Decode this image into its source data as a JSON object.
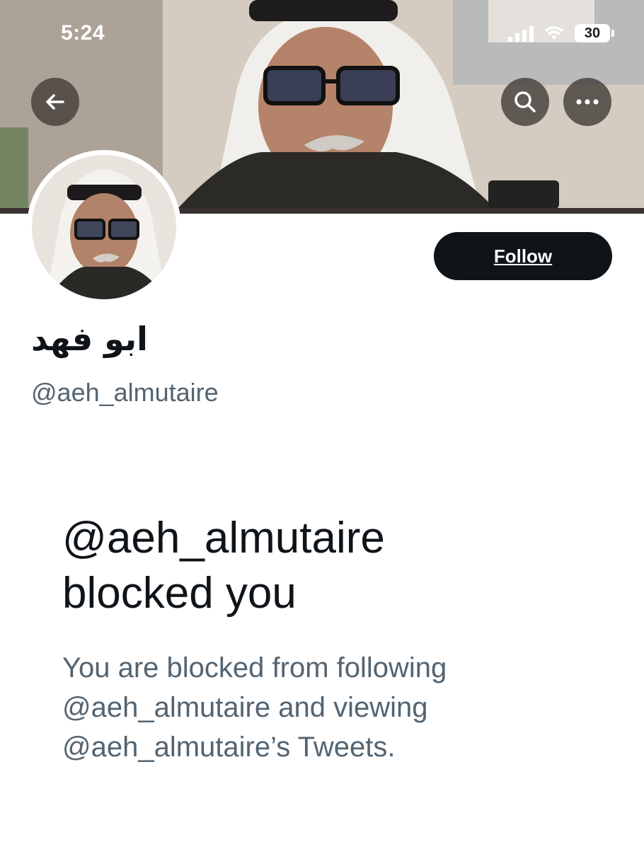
{
  "status_bar": {
    "time": "5:24",
    "battery": "30"
  },
  "profile": {
    "display_name": "ابو فهد",
    "handle": "@aeh_almutaire"
  },
  "actions": {
    "follow_label": "Follow"
  },
  "blocked": {
    "title_handle": "@aeh_almutaire",
    "title_rest": "blocked you",
    "desc_line1": "You are blocked from following",
    "desc_line2": "@aeh_almutaire and viewing",
    "desc_line3": "@aeh_almutaire’s Tweets."
  },
  "icons": {
    "back": "arrow-left-icon",
    "search": "search-icon",
    "more": "more-icon"
  }
}
